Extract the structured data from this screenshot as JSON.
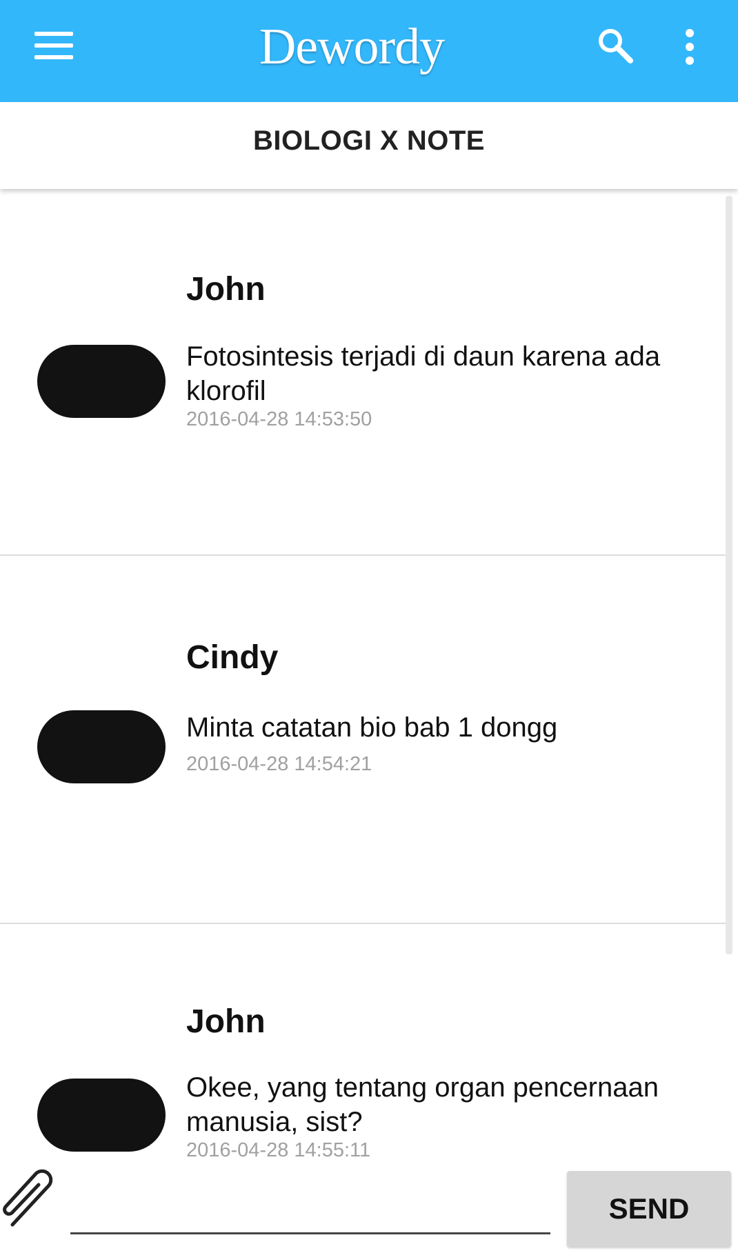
{
  "app_bar": {
    "logo_text": "Dewordy",
    "menu_icon": "hamburger-menu-icon",
    "search_icon": "search-icon",
    "more_icon": "more-vert-icon",
    "background": "#33b7fb"
  },
  "subheader": {
    "title": "BIOLOGI X NOTE"
  },
  "messages": [
    {
      "author": "John",
      "text": "Fotosintesis terjadi di daun karena ada klorofil",
      "time": "2016-04-28 14:53:50"
    },
    {
      "author": "Cindy",
      "text": "Minta catatan bio bab 1 dongg",
      "time": "2016-04-28 14:54:21"
    },
    {
      "author": "John",
      "text": "Okee, yang tentang organ pencernaan manusia, sist?",
      "time": "2016-04-28 14:55:11"
    }
  ],
  "composer": {
    "attach_icon": "paperclip-icon",
    "input_value": "",
    "send_label": "SEND"
  }
}
